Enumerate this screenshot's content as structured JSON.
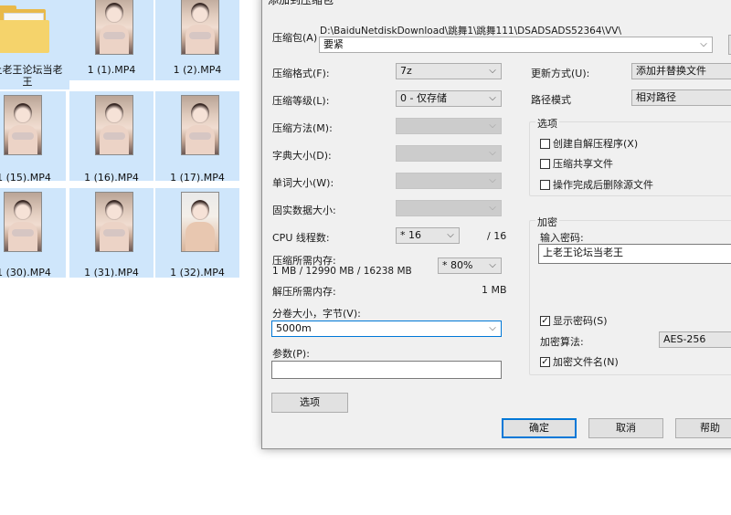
{
  "explorer": {
    "files": [
      {
        "label": "上老王论坛当老王",
        "kind": "folder"
      },
      {
        "label": "1 (1).MP4",
        "kind": "video"
      },
      {
        "label": "1 (2).MP4",
        "kind": "video"
      },
      {
        "label": "1 (15).MP4",
        "kind": "video"
      },
      {
        "label": "1 (16).MP4",
        "kind": "video"
      },
      {
        "label": "1 (17).MP4",
        "kind": "video"
      },
      {
        "label": "1 (30).MP4",
        "kind": "video"
      },
      {
        "label": "1 (31).MP4",
        "kind": "video"
      },
      {
        "label": "1 (32).MP4",
        "kind": "video"
      }
    ]
  },
  "dialog": {
    "title": "添加到压缩包",
    "archive": {
      "label": "压缩包(A)",
      "path": "D:\\BaiduNetdiskDownload\\跳舞1\\跳舞111\\DSADSADS52364\\VV\\",
      "name": "要紧"
    },
    "left": {
      "format_label": "压缩格式(F):",
      "format_value": "7z",
      "level_label": "压缩等级(L):",
      "level_value": "0 - 仅存储",
      "method_label": "压缩方法(M):",
      "dict_label": "字典大小(D):",
      "word_label": "单词大小(W):",
      "solid_label": "固实数据大小:",
      "cpu_label": "CPU 线程数:",
      "cpu_value": "* 16",
      "cpu_max": "/ 16",
      "mem_label": "压缩所需内存:",
      "mem_detail": "1 MB / 12990 MB / 16238 MB",
      "mem_value": "* 80%",
      "decomp_label": "解压所需内存:",
      "decomp_value": "1 MB",
      "split_label": "分卷大小，字节(V):",
      "split_value": "5000m",
      "params_label": "参数(P):",
      "params_value": "",
      "options_button": "选项"
    },
    "right": {
      "update_label": "更新方式(U):",
      "update_value": "添加并替换文件",
      "path_label": "路径模式",
      "path_value": "相对路径",
      "options_group": "选项",
      "options": [
        {
          "label": "创建自解压程序(X)",
          "checked": false
        },
        {
          "label": "压缩共享文件",
          "checked": false
        },
        {
          "label": "操作完成后删除源文件",
          "checked": false
        }
      ],
      "encrypt_group": "加密",
      "password_label": "输入密码:",
      "password_value": "上老王论坛当老王",
      "show_password": {
        "label": "显示密码(S)",
        "checked": true
      },
      "algo_label": "加密算法:",
      "algo_value": "AES-256",
      "encrypt_names": {
        "label": "加密文件名(N)",
        "checked": true
      }
    },
    "buttons": {
      "ok": "确定",
      "cancel": "取消",
      "help": "帮助"
    }
  }
}
